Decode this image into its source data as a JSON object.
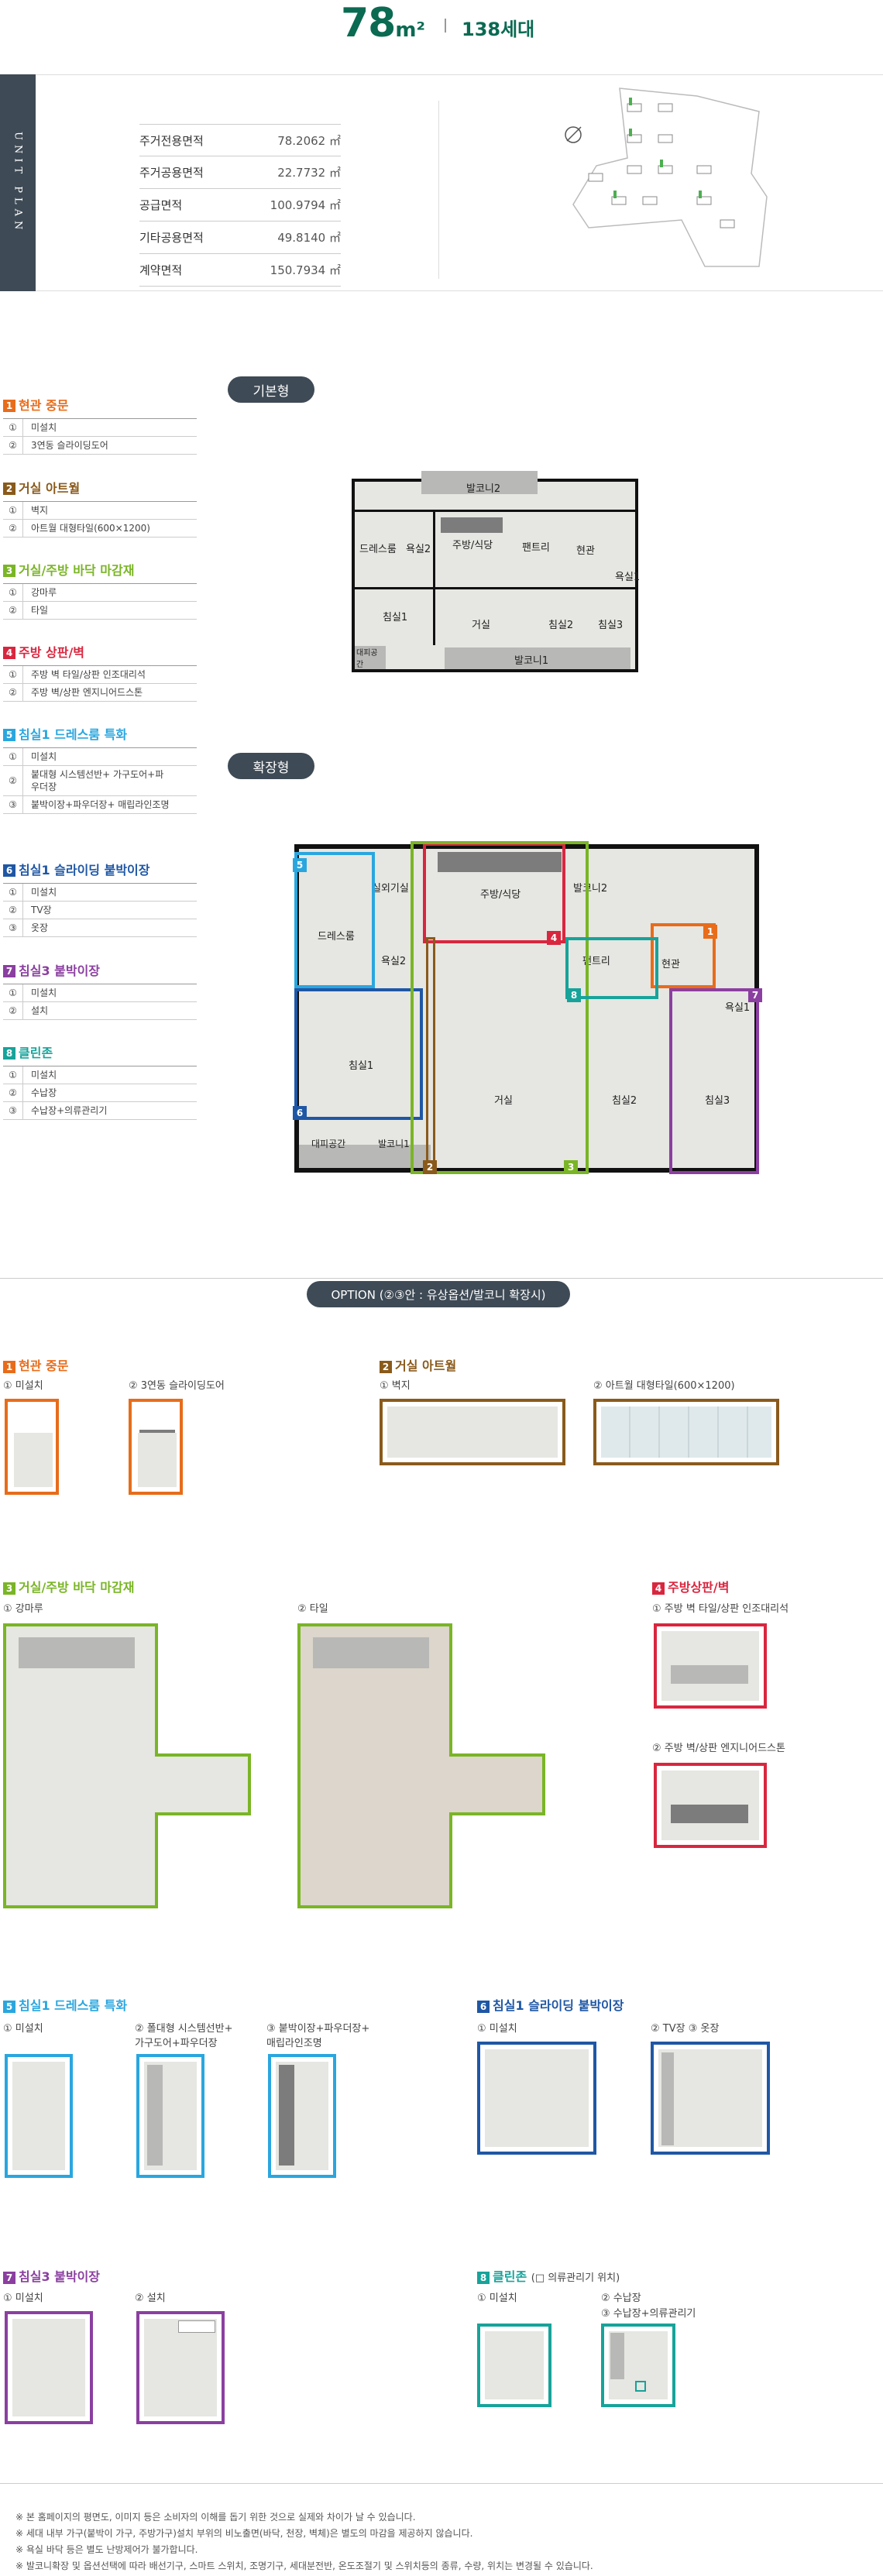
{
  "header": {
    "area_num": "78",
    "area_unit": "m²",
    "units": "138세대"
  },
  "side_label": "UNIT PLAN",
  "areas": [
    {
      "label": "주거전용면적",
      "value": "78.2062 ㎡"
    },
    {
      "label": "주거공용면적",
      "value": "22.7732 ㎡"
    },
    {
      "label": "공급면적",
      "value": "100.9794 ㎡"
    },
    {
      "label": "기타공용면적",
      "value": "49.8140 ㎡"
    },
    {
      "label": "계약면적",
      "value": "150.7934 ㎡"
    }
  ],
  "pills": {
    "basic": "기본형",
    "extended": "확장형",
    "option": "OPTION (②③안 : 유상옵션/발코니 확장시)"
  },
  "colors": {
    "c1": "#e86c1a",
    "c2": "#8a5a1b",
    "c3": "#7ab526",
    "c4": "#d9263f",
    "c5": "#2aa6df",
    "c6": "#1f57a5",
    "c7": "#8b3fa0",
    "c8": "#17a39a"
  },
  "groups": [
    {
      "n": "1",
      "title": "현관 중문",
      "color": "#e86c1a",
      "items": [
        {
          "c": "①",
          "t": "미설치"
        },
        {
          "c": "②",
          "t": "3연동 슬라이딩도어"
        }
      ]
    },
    {
      "n": "2",
      "title": "거실 아트월",
      "color": "#8a5a1b",
      "items": [
        {
          "c": "①",
          "t": "벽지"
        },
        {
          "c": "②",
          "t": "아트월 대형타일(600×1200)"
        }
      ]
    },
    {
      "n": "3",
      "title": "거실/주방 바닥 마감재",
      "color": "#7ab526",
      "items": [
        {
          "c": "①",
          "t": "강마루"
        },
        {
          "c": "②",
          "t": "타일"
        }
      ]
    },
    {
      "n": "4",
      "title": "주방 상판/벽",
      "color": "#d9263f",
      "items": [
        {
          "c": "①",
          "t": "주방 벽 타일/상판 인조대리석"
        },
        {
          "c": "②",
          "t": "주방 벽/상판 엔지니어드스톤"
        }
      ]
    },
    {
      "n": "5",
      "title": "침실1 드레스룸 특화",
      "color": "#2aa6df",
      "items": [
        {
          "c": "①",
          "t": "미설치"
        },
        {
          "c": "②",
          "t": "붙대형 시스템선반+ 가구도어+파우더장"
        },
        {
          "c": "③",
          "t": "붙박이장+파우더장+ 매립라인조명"
        }
      ]
    },
    {
      "n": "6",
      "title": "침실1 슬라이딩 붙박이장",
      "color": "#1f57a5",
      "items": [
        {
          "c": "①",
          "t": "미설치"
        },
        {
          "c": "②",
          "t": "TV장"
        },
        {
          "c": "③",
          "t": "옷장"
        }
      ]
    },
    {
      "n": "7",
      "title": "침실3 붙박이장",
      "color": "#8b3fa0",
      "items": [
        {
          "c": "①",
          "t": "미설치"
        },
        {
          "c": "②",
          "t": "설치"
        }
      ]
    },
    {
      "n": "8",
      "title": "클린존",
      "color": "#17a39a",
      "items": [
        {
          "c": "①",
          "t": "미설치"
        },
        {
          "c": "②",
          "t": "수납장"
        },
        {
          "c": "③",
          "t": "수납장+의류관리기"
        }
      ]
    }
  ],
  "basic_rooms": {
    "balcony2": "발코니2",
    "dress": "드레스룸",
    "bath2": "욕실2",
    "kitchen": "주방/식당",
    "pantry": "팬트리",
    "entry": "현관",
    "bath1": "욕실1",
    "bed1": "침실1",
    "living": "거실",
    "bed2": "침실2",
    "bed3": "침실3",
    "cabinet": "대피공간",
    "balcony1": "발코니1"
  },
  "ext_rooms": {
    "outdoor": "실외기실",
    "kitchen": "주방/식당",
    "balcony2": "발코니2",
    "dress": "드레스룸",
    "bath2": "욕실2",
    "pantry": "팬트리",
    "entry": "현관",
    "bath1": "욕실1",
    "bed1": "침실1",
    "living": "거실",
    "bed2": "침실2",
    "bed3": "침실3",
    "cabinet": "대피공간",
    "balcony1": "발코니1"
  },
  "opt": {
    "o1": {
      "title": "현관 중문",
      "a": "① 미설치",
      "b": "② 3연동 슬라이딩도어"
    },
    "o2": {
      "title": "거실 아트월",
      "a": "① 벽지",
      "b": "② 아트월 대형타일(600×1200)"
    },
    "o3": {
      "title": "거실/주방 바닥 마감재",
      "a": "① 강마루",
      "b": "② 타일"
    },
    "o4": {
      "title": "주방상판/벽",
      "a": "① 주방 벽 타일/상판 인조대리석",
      "b": "② 주방 벽/상판 엔지니어드스톤"
    },
    "o5": {
      "title": "침실1 드레스룸 특화",
      "a": "① 미설치",
      "b": "② 폴대형 시스템선반+ 가구도어+파우더장",
      "c": "③ 붙박이장+파우더장+ 매립라인조명"
    },
    "o6": {
      "title": "침실1 슬라이딩 붙박이장",
      "a": "① 미설치",
      "b": "② TV장  ③ 옷장"
    },
    "o7": {
      "title": "침실3 붙박이장",
      "a": "① 미설치",
      "b": "② 설치"
    },
    "o8": {
      "title": "클린존",
      "note": "(□ 의류관리기 위치)",
      "a": "① 미설치",
      "b": "② 수납장",
      "c": "③ 수납장+의류관리기"
    }
  },
  "notes": [
    "※ 본 홈페이지의 평면도, 이미지 등은 소비자의 이해를 돕기 위한 것으로 실제와 차이가 날 수 있습니다.",
    "※ 세대 내부 가구(붙박이 가구, 주방가구)설치 부위의 비노출면(바닥, 천장, 벽체)은 별도의 마감을 제공하지 않습니다.",
    "※ 욕실 바닥 등은 별도 난방제어가 불가합니다.",
    "※ 발코니확장 및 옵션선택에 따라 배선기구, 스마트 스위치, 조명기구, 세대분전반, 온도조절기 및 스위치등의 종류, 수량, 위치는 변경될 수 있습니다."
  ]
}
